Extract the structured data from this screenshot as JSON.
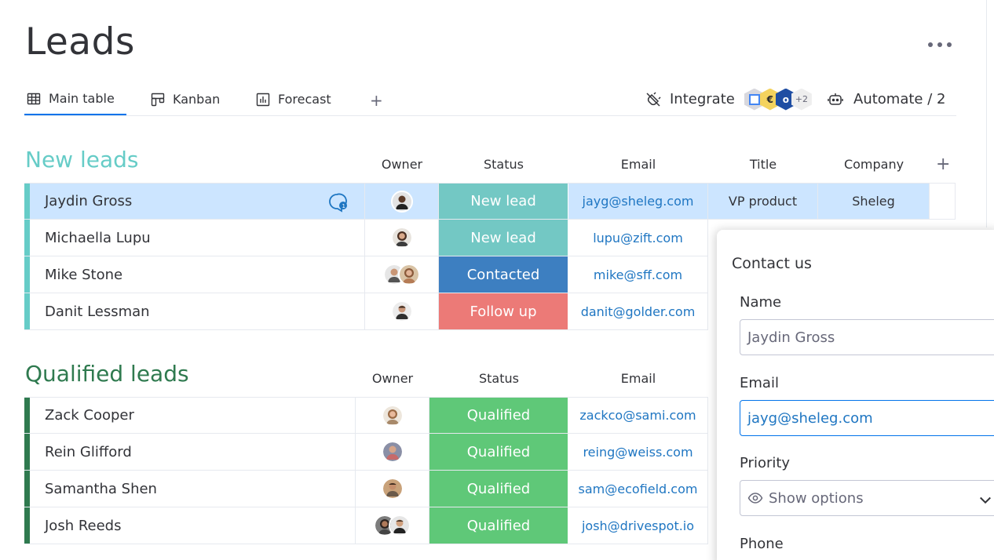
{
  "page": {
    "title": "Leads"
  },
  "tabs": {
    "main_table": "Main table",
    "kanban": "Kanban",
    "forecast": "Forecast",
    "add": "+"
  },
  "toolbar": {
    "integrate": "Integrate",
    "apps_more": "+2",
    "automate": "Automate / 2"
  },
  "groups": [
    {
      "title": "New leads",
      "color": "#66ccc7",
      "columns": {
        "owner": "Owner",
        "status": "Status",
        "email": "Email",
        "title": "Title",
        "company": "Company",
        "add": "+"
      },
      "rows": [
        {
          "name": "Jaydin Gross",
          "status": "New lead",
          "status_color": "#73c8c4",
          "email": "jayg@sheleg.com",
          "title": "VP product",
          "company": "Sheleg"
        },
        {
          "name": "Michaella Lupu",
          "status": "New lead",
          "status_color": "#73c8c4",
          "email": "lupu@zift.com",
          "title": "",
          "company": ""
        },
        {
          "name": "Mike Stone",
          "status": "Contacted",
          "status_color": "#3d7fc1",
          "email": "mike@sff.com",
          "title": "",
          "company": ""
        },
        {
          "name": "Danit Lessman",
          "status": "Follow up",
          "status_color": "#ec7a77",
          "email": "danit@golder.com",
          "title": "",
          "company": ""
        }
      ]
    },
    {
      "title": "Qualified leads",
      "color": "#2f7a4f",
      "columns": {
        "owner": "Owner",
        "status": "Status",
        "email": "Email"
      },
      "rows": [
        {
          "name": "Zack Cooper",
          "status": "Qualified",
          "status_color": "#5fc878",
          "email": "zackco@sami.com"
        },
        {
          "name": "Rein Glifford",
          "status": "Qualified",
          "status_color": "#5fc878",
          "email": "reing@weiss.com"
        },
        {
          "name": "Samantha Shen",
          "status": "Qualified",
          "status_color": "#5fc878",
          "email": "sam@ecofield.com"
        },
        {
          "name": "Josh Reeds",
          "status": "Qualified",
          "status_color": "#5fc878",
          "email": "josh@drivespot.io"
        }
      ]
    }
  ],
  "contact_panel": {
    "title": "Contact us",
    "name_label": "Name",
    "name_value": "Jaydin Gross",
    "email_label": "Email",
    "email_value": "jayg@sheleg.com",
    "priority_label": "Priority",
    "priority_placeholder": "Show options",
    "phone_label": "Phone"
  },
  "colors": {
    "accent": "#0073ea",
    "selected_row": "#cce5ff"
  }
}
